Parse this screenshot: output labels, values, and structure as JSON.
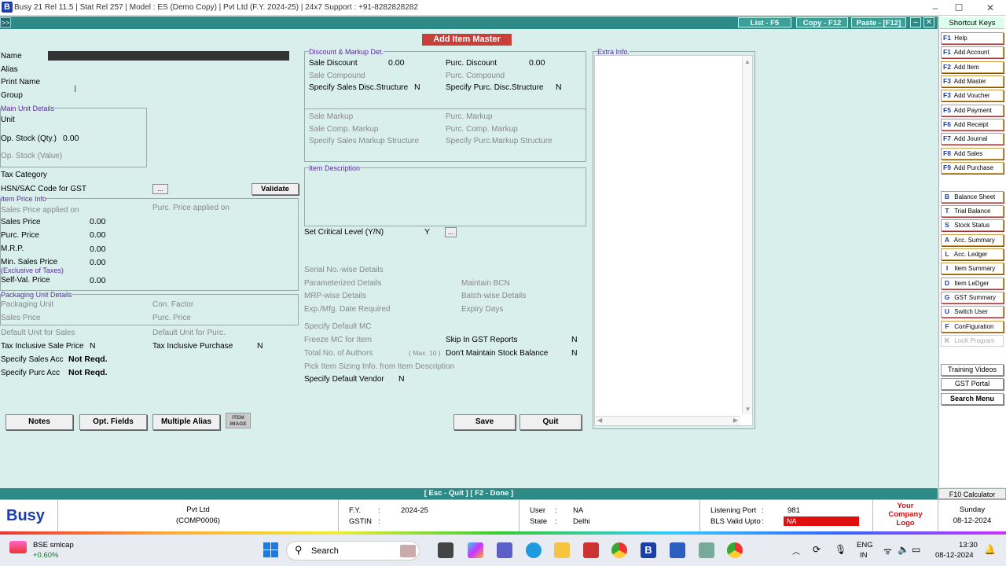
{
  "titlebar": {
    "title": "Busy 21  Rel 11.5  |  Stat Rel 257  |  Model : ES (Demo Copy)  |  Pvt Ltd (F.Y. 2024-25)  |  24x7 Support : +91-8282828282",
    "logo": "B",
    "min": "–",
    "max": "☐",
    "close": "✕"
  },
  "toolbar": {
    "arrow": ">>",
    "list": "List - F5",
    "copy": "Copy - F12",
    "paste": "Paste - [F12]",
    "min": "–",
    "close": "✕"
  },
  "form": {
    "title": "Add Item Master",
    "name": "Name",
    "alias": "Alias",
    "print_name": "Print Name",
    "group": "Group",
    "main_unit": "Main Unit Details",
    "unit": "Unit",
    "op_stock_qty": "Op. Stock (Qty.)",
    "op_stock_qty_val": "0.00",
    "op_stock_value": "Op. Stock (Value)",
    "tax_category": "Tax Category",
    "hsn": "HSN/SAC Code for GST",
    "dots": "...",
    "validate": "Validate",
    "item_price_info": "Item Price Info",
    "sales_price_applied": "Sales Price applied on",
    "purc_price_applied": "Purc. Price applied on",
    "sales_price": "Sales Price",
    "purc_price": "Purc. Price",
    "mrp": "M.R.P.",
    "min_sales_price": "Min. Sales Price",
    "excl_tax": "(Exclusive of Taxes)",
    "self_val": "Self-Val. Price",
    "zero": "0.00",
    "packaging": "Packaging Unit Details",
    "packaging_unit": "Packaging Unit",
    "con_factor": "Con. Factor",
    "pk_sales_price": "Sales Price",
    "pk_purc_price": "Purc. Price",
    "default_unit_sales": "Default Unit for Sales",
    "default_unit_purc": "Default Unit for Purc.",
    "tax_incl_sale": "Tax Inclusive Sale Price",
    "tax_incl_purchase": "Tax Inclusive Purchase",
    "n": "N",
    "specify_sales_acc": "Specify Sales Acc",
    "specify_purc_acc": "Specify Purc Acc",
    "not_reqd": "Not Reqd.",
    "disc_markup": "Discount & Markup Det.",
    "sale_discount": "Sale Discount",
    "purc_discount": "Purc. Discount",
    "sale_compound": "Sale Compound",
    "purc_compound": "Purc. Compound",
    "spec_sales_disc": "Specify Sales Disc.Structure",
    "spec_purc_disc": "Specify  Purc. Disc.Structure",
    "sale_markup": "Sale Markup",
    "purc_markup": "Purc. Markup",
    "sale_comp_markup": "Sale Comp. Markup",
    "purc_comp_markup": "Purc. Comp. Markup",
    "spec_sales_markup": "Specify Sales Markup Structure",
    "spec_purc_markup": "Specify  Purc.Markup Structure",
    "item_desc": "Item Description",
    "critical": "Set Critical Level (Y/N)",
    "y": "Y",
    "serial": "Serial No.-wise Details",
    "param": "Parameterized Details",
    "maintain_bcn": "Maintain BCN",
    "mrp_wise": "MRP-wise Details",
    "batch_wise": "Batch-wise Details",
    "exp_mfg": "Exp./Mfg. Date Required",
    "expiry_days": "Expiry Days",
    "default_mc": "Specify Default MC",
    "freeze_mc": "Freeze MC for Item",
    "skip_gst": "Skip In GST Reports",
    "authors": "Total No. of Authors",
    "max10": "( Max. 10 )",
    "dont_maintain": "Don't Maintain Stock Balance",
    "pick_sizing": "Pick Item Sizing Info. from Item Description",
    "default_vendor": "Specify Default Vendor",
    "extra_info": "Extra Info.",
    "notes": "Notes",
    "opt_fields": "Opt. Fields",
    "multiple_alias": "Multiple Alias",
    "item_image": "ITEM IMAGE",
    "save": "Save",
    "quit": "Quit"
  },
  "shortcuts": {
    "title": "Shortcut Keys",
    "items": [
      {
        "k": "F1",
        "l": "Help"
      },
      {
        "k": "F1",
        "l": "Add Account"
      },
      {
        "k": "F2",
        "l": "Add Item"
      },
      {
        "k": "F3",
        "l": "Add Master"
      },
      {
        "k": "F3",
        "l": "Add Voucher"
      },
      {
        "k": "F5",
        "l": "Add Payment"
      },
      {
        "k": "F6",
        "l": "Add Receipt"
      },
      {
        "k": "F7",
        "l": "Add Journal"
      },
      {
        "k": "F8",
        "l": "Add Sales"
      },
      {
        "k": "F9",
        "l": "Add Purchase"
      },
      {
        "k": "B",
        "l": "Balance Sheet"
      },
      {
        "k": "T",
        "l": "Trial Balance"
      },
      {
        "k": "S",
        "l": "Stock Status"
      },
      {
        "k": "A",
        "l": "Acc. Summary"
      },
      {
        "k": "L",
        "l": "Acc. Ledger"
      },
      {
        "k": "I",
        "l": "Item Summary"
      },
      {
        "k": "D",
        "l": "Item LeDger"
      },
      {
        "k": "G",
        "l": "GST Summary"
      },
      {
        "k": "U",
        "l": "Switch User"
      },
      {
        "k": "F",
        "l": "ConFiguration"
      },
      {
        "k": "K",
        "l": "LocK Program"
      }
    ],
    "training": "Training Videos",
    "gst_portal": "GST Portal",
    "search_menu": "Search Menu",
    "calc": "F10 Calculator"
  },
  "status": {
    "text": "[ Esc - Quit ]    [ F2 - Done ]"
  },
  "footer": {
    "brand": "Busy",
    "company": "Pvt Ltd",
    "code": "(COMP0006)",
    "fy_label": "F.Y.",
    "fy": "2024-25",
    "gstin_label": "GSTIN",
    "colon": ":",
    "user_label": "User",
    "user": "NA",
    "state_label": "State",
    "state": "Delhi",
    "port_label": "Listening Port",
    "port": "981",
    "bls_label": "BLS Valid Upto",
    "bls": "NA",
    "logo": "Your Company Logo",
    "day": "Sunday",
    "date": "08-12-2024"
  },
  "taskbar": {
    "stock": "BSE smlcap",
    "change": "+0.60%",
    "search": "Search",
    "lang1": "ENG",
    "lang2": "IN",
    "time": "13:30",
    "tdate": "08-12-2024"
  }
}
